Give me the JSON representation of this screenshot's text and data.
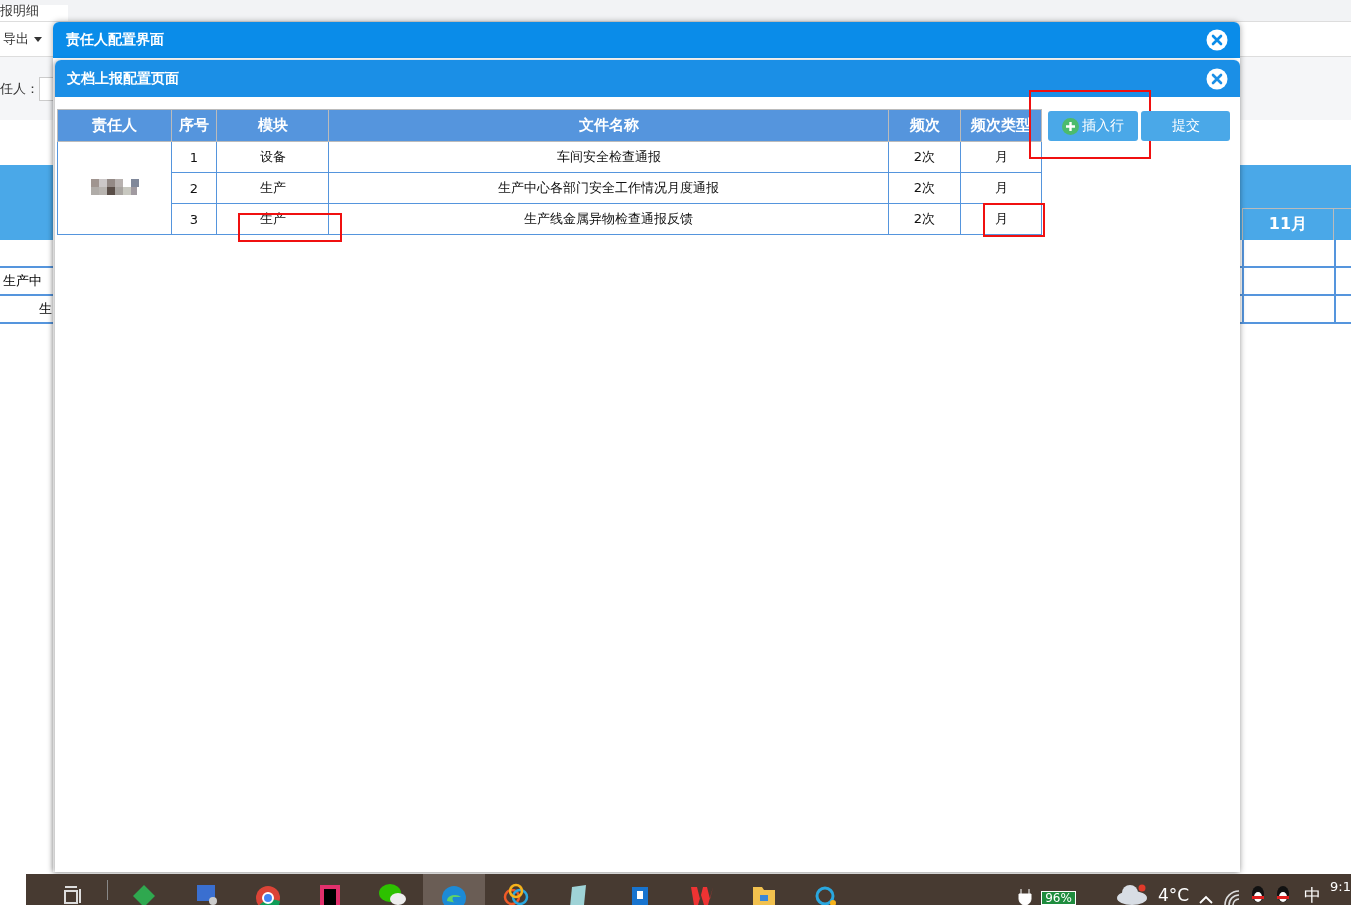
{
  "background": {
    "tab": "报明细",
    "export_button": "导出",
    "filter_label": "任人：",
    "month_header": "11月",
    "rows": [
      "生产中",
      "生"
    ]
  },
  "outer_dialog": {
    "title": "责任人配置界面"
  },
  "inner_dialog": {
    "title": "文档上报配置页面",
    "table": {
      "columns": [
        "责任人",
        "序号",
        "模块",
        "文件名称",
        "频次",
        "频次类型"
      ],
      "rows": [
        {
          "no": "1",
          "module": "设备",
          "file": "车间安全检查通报",
          "freq": "2次",
          "freq_type": "月",
          "module_marked": false,
          "type_marked": false
        },
        {
          "no": "2",
          "module": "生产",
          "file": "生产中心各部门安全工作情况月度通报",
          "freq": "2次",
          "freq_type": "月",
          "module_marked": false,
          "type_marked": false
        },
        {
          "no": "3",
          "module": "生产",
          "file": "生产线金属异物检查通报反馈",
          "freq": "2次",
          "freq_type": "月",
          "module_marked": true,
          "type_marked": true
        }
      ]
    },
    "buttons": [
      {
        "kind": "insert",
        "label": "插入行",
        "marked": true
      },
      {
        "kind": "submit",
        "label": "提交",
        "marked": false
      }
    ]
  },
  "taskbar": {
    "apps": [
      {
        "kind": "taskview",
        "selected": false
      },
      {
        "kind": "diamond",
        "selected": false
      },
      {
        "kind": "monitor",
        "selected": false
      },
      {
        "kind": "chrome",
        "selected": false
      },
      {
        "kind": "ide",
        "selected": false
      },
      {
        "kind": "chat",
        "selected": false
      },
      {
        "kind": "edge",
        "selected": true
      },
      {
        "kind": "petals",
        "selected": false
      },
      {
        "kind": "tablet",
        "selected": false
      },
      {
        "kind": "tile",
        "selected": false
      },
      {
        "kind": "wps",
        "selected": false
      },
      {
        "kind": "folder",
        "selected": false
      },
      {
        "kind": "ring",
        "selected": false
      }
    ],
    "battery": "96%",
    "temperature": "4°C",
    "ime": "中",
    "clock": "9:1"
  }
}
